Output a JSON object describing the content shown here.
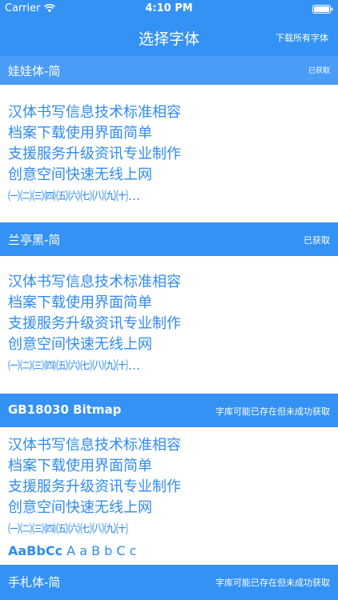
{
  "status_bar": {
    "carrier": "Carrier",
    "time": "4:10 PM"
  },
  "nav": {
    "title": "选择字体",
    "download_all": "下载所有字体"
  },
  "fonts": [
    {
      "name": "娃娃体-简",
      "status": "已获取",
      "lines": [
        "汉体书写信息技术标准相容",
        "档案下载使用界面简单",
        "支援服务升级资讯专业制作",
        "创意空间快速无线上网",
        "㈠㈡㈢㈣㈤㈥㈦㈧㈨㈩…"
      ]
    },
    {
      "name": "兰亭黑-简",
      "status": "已获取",
      "lines": [
        "汉体书写信息技术标准相容",
        "档案下载使用界面简单",
        "支援服务升级资讯专业制作",
        "创意空间快速无线上网",
        "㈠㈡㈢㈣㈤㈥㈦㈧㈨㈩…"
      ]
    },
    {
      "name": "GB18030 Bitmap",
      "status": "字库可能已存在但未成功获取",
      "lines": [
        "汉体书写信息技术标准相容",
        "档案下载使用界面简单",
        "支援服务升级资讯专业制作",
        "创意空间快速无线上网",
        "㈠㈡㈢㈣㈤㈥㈦㈧㈨㈩"
      ],
      "latin_bold": "AaBbCc",
      "latin_regular": "A a B b C c"
    },
    {
      "name": "手札体-简",
      "status": "字库可能已存在但未成功获取"
    }
  ],
  "colors": {
    "accent": "#3592f5",
    "text": "#2f8bf0",
    "background": "#ffffff"
  }
}
